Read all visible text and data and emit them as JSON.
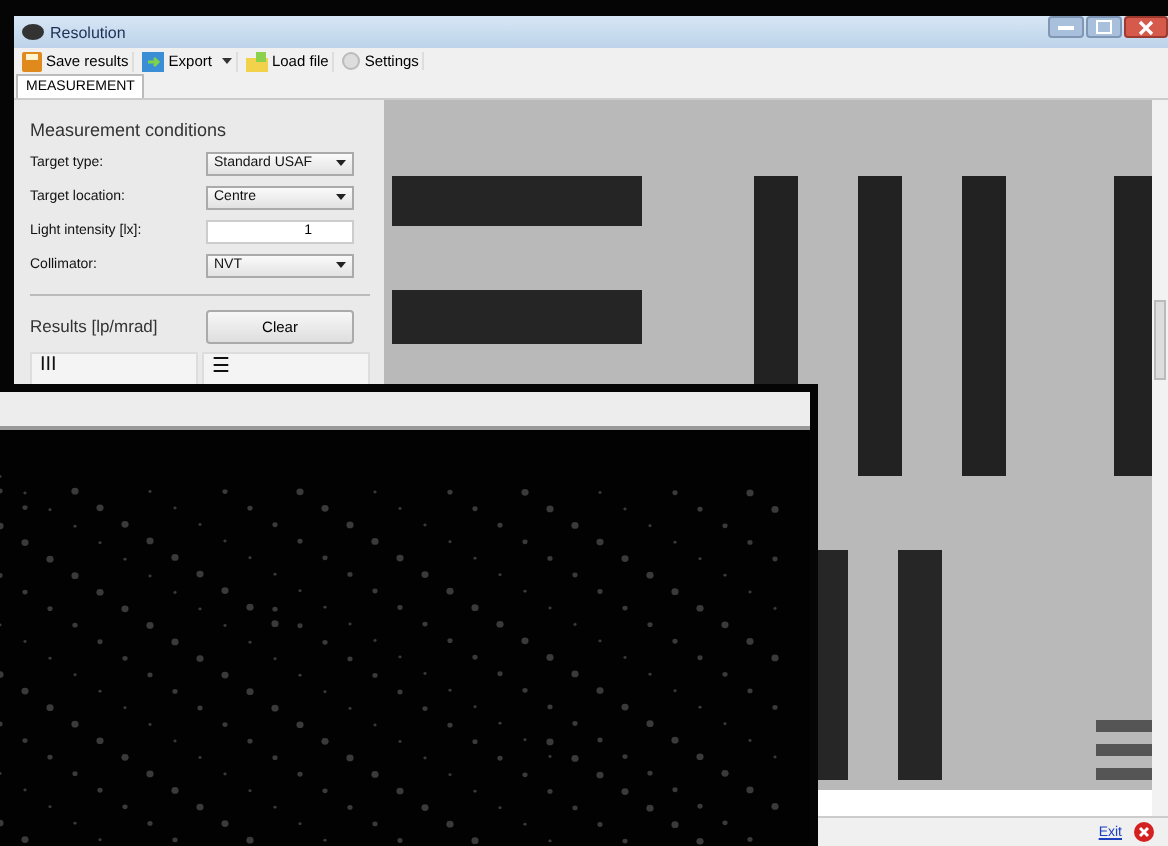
{
  "window": {
    "title": "Resolution"
  },
  "toolbar": [
    {
      "label": "Save results",
      "kind": "save",
      "menu": false
    },
    {
      "label": "Export",
      "kind": "export",
      "menu": true
    },
    {
      "label": "Load file",
      "kind": "load",
      "menu": false
    },
    {
      "label": "Settings",
      "kind": "settings",
      "menu": false
    }
  ],
  "tabs": [
    {
      "label": "MEASUREMENT",
      "selected": true
    }
  ],
  "conditions": {
    "title": "Measurement conditions",
    "fields": [
      {
        "label": "Target type:",
        "kind": "dropdown",
        "value": "Standard USAF"
      },
      {
        "label": "Target location:",
        "kind": "dropdown",
        "value": "Centre"
      },
      {
        "label": "Light intensity [lx]:",
        "kind": "number",
        "value": "1"
      },
      {
        "label": "Collimator:",
        "kind": "dropdown",
        "value": "NVT"
      }
    ]
  },
  "results": {
    "label": "Results [lp/mrad]",
    "button": "Clear",
    "columns": [
      "III",
      "☰"
    ]
  },
  "status_bar": {
    "link": "Exit"
  }
}
